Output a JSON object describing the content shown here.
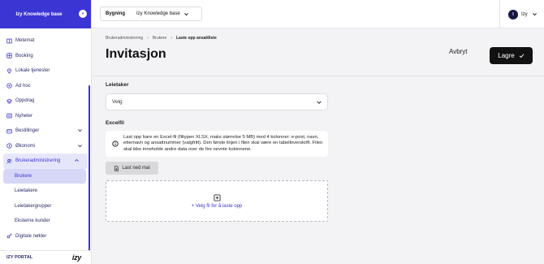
{
  "sidebar": {
    "title": "Izy Knowledge base",
    "collapse_icon": "collapse-left-icon",
    "items": [
      {
        "label": "Metemat",
        "icon": "menu-book-icon"
      },
      {
        "label": "Booking",
        "icon": "booking-icon"
      },
      {
        "label": "Lokale tjenester",
        "icon": "location-pin-icon"
      },
      {
        "label": "Ad hoc",
        "icon": "target-icon"
      },
      {
        "label": "Oppdrag",
        "icon": "task-icon"
      },
      {
        "label": "Nyheter",
        "icon": "news-icon"
      },
      {
        "label": "Bestillinger",
        "icon": "orders-icon"
      },
      {
        "label": "Økonomi",
        "icon": "money-icon"
      },
      {
        "label": "Brukeradministrering",
        "icon": "users-icon"
      }
    ],
    "subitems": [
      "Brukere",
      "Leietakere",
      "Leietakergrupper",
      "Eksterne kunder"
    ],
    "after_items": [
      {
        "label": "Digitale nøkler",
        "icon": "key-icon"
      }
    ],
    "footer_label": "IZY PORTAL",
    "footer_logo": "izy"
  },
  "topbar": {
    "context_label": "Bygning",
    "context_value": "Izy Knowledge base",
    "user_initial": "I",
    "user_name": "Izy"
  },
  "page": {
    "breadcrumb": [
      "Brukeradministrering",
      "Brukere",
      "Laste opp ansattliste"
    ],
    "title": "Invitasjon",
    "cancel_label": "Avbryt",
    "save_label": "Lagre"
  },
  "form": {
    "tenant_label": "Leietaker",
    "tenant_placeholder": "Velg",
    "excel_label": "Excelfil",
    "info_text": "Last opp bare en Excel-fil (filtypen XLSX, maks størrelse 5 MB) med 4 kolonner: e-post, navn, etternavn og ansattnummer (valgfritt). Den første linjen i filen skal være en tabelloverskrift. Filen skal ikke inneholde andre data over de fire nevnte kolonnene.",
    "template_button": "Last ned mal",
    "upload_link": "+ Velg fil for å laste opp"
  },
  "colors": {
    "accent": "#3b35d4",
    "dark": "#111111"
  }
}
